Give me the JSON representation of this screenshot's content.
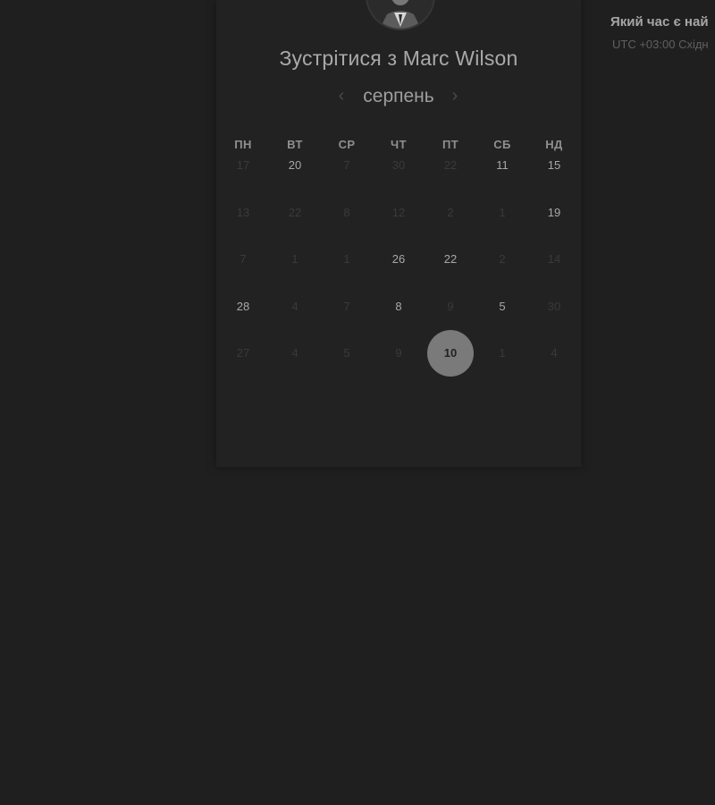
{
  "meeting": {
    "title": "Зустрітися з Marc Wilson"
  },
  "calendar": {
    "month": "серпень",
    "prev_icon": "chevron-left-icon",
    "next_icon": "chevron-right-icon",
    "weekdays": [
      "ПН",
      "ВТ",
      "СР",
      "ЧТ",
      "ПТ",
      "СБ",
      "НД"
    ],
    "rows": [
      [
        {
          "t": "17",
          "s": "inactive"
        },
        {
          "t": "20",
          "s": "active"
        },
        {
          "t": "7",
          "s": "inactive"
        },
        {
          "t": "30",
          "s": "inactive"
        },
        {
          "t": "22",
          "s": "inactive"
        },
        {
          "t": "11",
          "s": "active"
        },
        {
          "t": "15",
          "s": "active"
        }
      ],
      [
        {
          "t": "13",
          "s": "inactive"
        },
        {
          "t": "22",
          "s": "inactive"
        },
        {
          "t": "8",
          "s": "inactive"
        },
        {
          "t": "12",
          "s": "inactive"
        },
        {
          "t": "2",
          "s": "inactive"
        },
        {
          "t": "1",
          "s": "inactive"
        },
        {
          "t": "19",
          "s": "active"
        }
      ],
      [
        {
          "t": "7",
          "s": "inactive"
        },
        {
          "t": "1",
          "s": "inactive"
        },
        {
          "t": "1",
          "s": "inactive"
        },
        {
          "t": "26",
          "s": "active"
        },
        {
          "t": "22",
          "s": "active"
        },
        {
          "t": "2",
          "s": "inactive"
        },
        {
          "t": "14",
          "s": "inactive"
        }
      ],
      [
        {
          "t": "28",
          "s": "active"
        },
        {
          "t": "4",
          "s": "inactive"
        },
        {
          "t": "7",
          "s": "inactive"
        },
        {
          "t": "8",
          "s": "active"
        },
        {
          "t": "9",
          "s": "inactive"
        },
        {
          "t": "5",
          "s": "active"
        },
        {
          "t": "30",
          "s": "inactive"
        }
      ],
      [
        {
          "t": "27",
          "s": "inactive"
        },
        {
          "t": "4",
          "s": "inactive"
        },
        {
          "t": "5",
          "s": "inactive"
        },
        {
          "t": "9",
          "s": "inactive"
        },
        {
          "t": "10",
          "s": "selected"
        },
        {
          "t": "1",
          "s": "inactive"
        },
        {
          "t": "4",
          "s": "inactive"
        }
      ]
    ]
  },
  "side_panel": {
    "title": "Який час є най",
    "timezone": "UTC +03:00 Східн"
  }
}
